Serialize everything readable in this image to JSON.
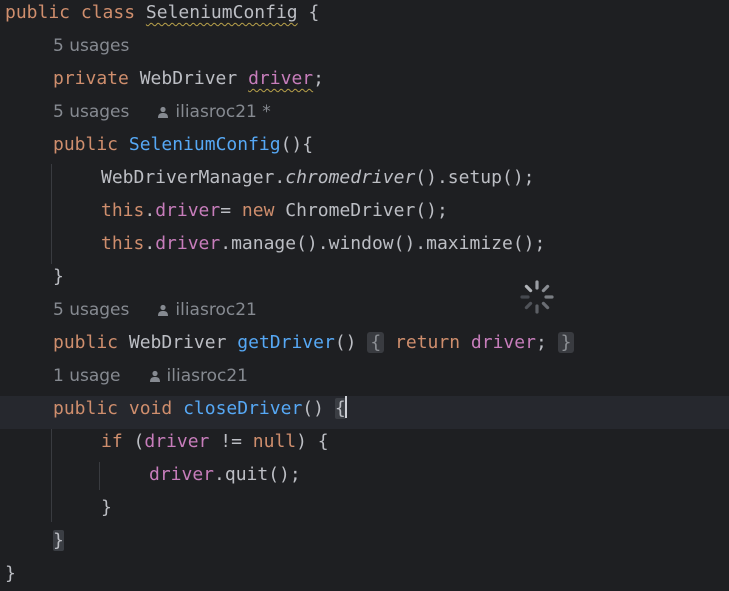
{
  "code": {
    "l1": {
      "kw1": "public",
      "kw2": "class",
      "cls": "SeleniumConfig",
      "brace": "{"
    },
    "h1": {
      "usages": "5 usages"
    },
    "l2": {
      "kw": "private",
      "type": "WebDriver",
      "field": "driver",
      "semi": ";"
    },
    "h2": {
      "usages": "5 usages",
      "author": "iliasroc21 *"
    },
    "l3": {
      "kw": "public",
      "ctor": "SeleniumConfig",
      "rest": "(){"
    },
    "l4": {
      "obj": "WebDriverManager.",
      "method": "chromedriver",
      "rest": "().setup();"
    },
    "l5": {
      "kw_this": "this",
      "dot": ".",
      "field": "driver",
      "eq": "= ",
      "kw_new": "new",
      "rest": " ChromeDriver();"
    },
    "l6": {
      "kw_this": "this",
      "dot": ".",
      "field": "driver",
      "rest": ".manage().window().maximize();"
    },
    "l7": {
      "brace": "}"
    },
    "h3": {
      "usages": "5 usages",
      "author": "iliasroc21"
    },
    "l8": {
      "kw": "public",
      "type": "WebDriver",
      "method": "getDriver",
      "parens": "()",
      "open": "{",
      "kw_return": "return",
      "field": "driver",
      "semi": ";",
      "close": "}"
    },
    "h4": {
      "usages": "1 usage",
      "author": "iliasroc21"
    },
    "l9": {
      "kw1": "public",
      "kw2": "void",
      "method": "closeDriver",
      "parens": "() ",
      "brace": "{"
    },
    "l10": {
      "kw_if": "if",
      "open": " (",
      "field": "driver",
      "op": " != ",
      "kw_null": "null",
      "rest": ") {"
    },
    "l11": {
      "field": "driver",
      "rest": ".quit();"
    },
    "l12": {
      "brace": "}"
    },
    "l13": {
      "brace": "}"
    },
    "l14": {
      "brace": "}"
    }
  },
  "colors": {
    "background": "#1e1f22",
    "keyword": "#cf8e6d",
    "field": "#c77dbb",
    "function": "#56a8f5",
    "text": "#bcbec4",
    "hint": "#868a91"
  },
  "icons": {
    "author": "person-icon",
    "loading": "loading-spinner-icon"
  }
}
